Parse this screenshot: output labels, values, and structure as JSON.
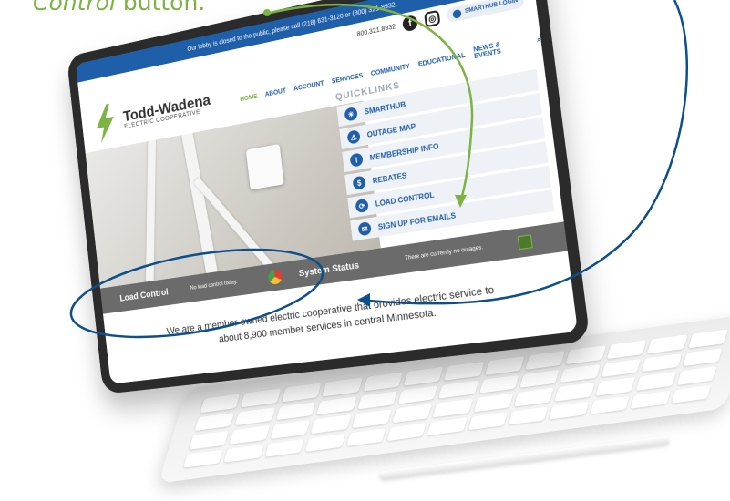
{
  "caption": {
    "italic": "Control",
    "rest": " button."
  },
  "site": {
    "topbar": "Our lobby is closed to the public, please call (218) 631-3120 or (800) 321-8932.",
    "phone": "800.321.8932",
    "facebook_glyph": "f",
    "instagram_glyph": "◎",
    "smarthub_login": "SMARTHUB LOGIN",
    "logo_name": "Todd-Wadena",
    "logo_sub": "ELECTRIC COOPERATIVE",
    "nav": [
      "HOME",
      "ABOUT",
      "ACCOUNT",
      "SERVICES",
      "COMMUNITY",
      "EDUCATIONAL",
      "NEWS & EVENTS"
    ],
    "search_glyph": "⌕",
    "quicklinks_title": "QUICKLINKS",
    "quicklinks": [
      {
        "label": "SMARTHUB",
        "icon": "☀"
      },
      {
        "label": "OUTAGE MAP",
        "icon": "⚠"
      },
      {
        "label": "MEMBERSHIP INFO",
        "icon": "i"
      },
      {
        "label": "REBATES",
        "icon": "$"
      },
      {
        "label": "LOAD CONTROL",
        "icon": "⟳"
      },
      {
        "label": "SIGN UP FOR EMAILS",
        "icon": "✉"
      }
    ],
    "load_control_label": "Load Control",
    "load_control_msg": "No load control today.",
    "system_status_label": "System Status",
    "system_status_msg": "There are currently no outages.",
    "about_line1": "We are a member-owned electric cooperative that provides electric service to",
    "about_line2": "about 8,900 member services in central Minnesota."
  },
  "colors": {
    "accent_green": "#7cb342",
    "brand_blue": "#1f5ea8",
    "annotation_blue": "#0d4f8b"
  }
}
